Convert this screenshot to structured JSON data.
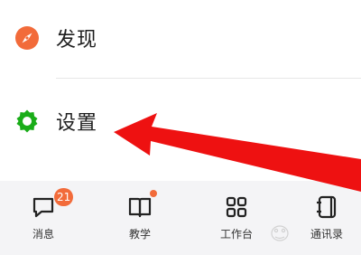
{
  "menu": {
    "discover_label": "发现",
    "settings_label": "设置"
  },
  "tabbar": {
    "messages_label": "消息",
    "messages_badge": "21",
    "teaching_label": "教学",
    "workbench_label": "工作台",
    "contacts_label": "通讯录"
  },
  "colors": {
    "discover_icon": "#f26b3a",
    "settings_icon": "#1aad19",
    "badge": "#f26b3a",
    "arrow": "#ee1111"
  },
  "icons": {
    "discover": "compass-icon",
    "settings": "gear-icon",
    "messages": "chat-bubble-icon",
    "teaching": "book-icon",
    "workbench": "grid-icon",
    "contacts": "address-book-icon"
  }
}
